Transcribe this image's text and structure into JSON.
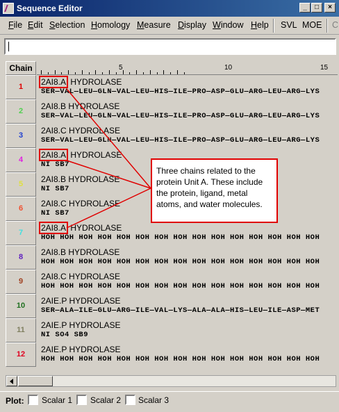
{
  "window": {
    "title": "Sequence Editor"
  },
  "menu": [
    {
      "label": "File",
      "ul": "F",
      "rest": "ile"
    },
    {
      "label": "Edit",
      "ul": "E",
      "rest": "dit"
    },
    {
      "label": "Selection",
      "ul": "S",
      "rest": "election"
    },
    {
      "label": "Homology",
      "ul": "H",
      "rest": "omology"
    },
    {
      "label": "Measure",
      "ul": "M",
      "rest": "easure"
    },
    {
      "label": "Display",
      "ul": "D",
      "rest": "isplay"
    },
    {
      "label": "Window",
      "ul": "W",
      "rest": "indow"
    },
    {
      "label": "Help",
      "ul": "H",
      "rest": "elp"
    }
  ],
  "toolbar": {
    "svl": "SVL",
    "moe": "MOE",
    "extra": "C"
  },
  "command": {
    "value": ""
  },
  "ruler": {
    "header": "Chain",
    "marks": [
      "5",
      "10",
      "15"
    ]
  },
  "rows": [
    {
      "chain": "1",
      "color": "#e00000",
      "pdb": "2AI8.A",
      "name": "HYDROLASE",
      "highlight": true,
      "residues": "SER—VAL—LEU—GLN—VAL—LEU—HIS—ILE—PRO—ASP—GLU—ARG—LEU—ARG—LYS"
    },
    {
      "chain": "2",
      "color": "#50d050",
      "pdb": "2AI8.B",
      "name": "HYDROLASE",
      "highlight": false,
      "residues": "SER—VAL—LEU—GLN—VAL—LEU—HIS—ILE—PRO—ASP—GLU—ARG—LEU—ARG—LYS"
    },
    {
      "chain": "3",
      "color": "#2040d0",
      "pdb": "2AI8.C",
      "name": "HYDROLASE",
      "highlight": false,
      "residues": "SER—VAL—LEU—GLN—VAL—LEU—HIS—ILE—PRO—ASP—GLU—ARG—LEU—ARG—LYS"
    },
    {
      "chain": "4",
      "color": "#e020e0",
      "pdb": "2AI8.A",
      "name": "HYDROLASE",
      "highlight": true,
      "residues": "NI  SB7"
    },
    {
      "chain": "5",
      "color": "#e0e040",
      "pdb": "2AI8.B",
      "name": "HYDROLASE",
      "highlight": false,
      "residues": "NI  SB7"
    },
    {
      "chain": "6",
      "color": "#f05030",
      "pdb": "2AI8.C",
      "name": "HYDROLASE",
      "highlight": false,
      "residues": "NI  SB7"
    },
    {
      "chain": "7",
      "color": "#40e0e0",
      "pdb": "2AI8.A",
      "name": "HYDROLASE",
      "highlight": true,
      "residues": "HOH HOH HOH HOH HOH HOH HOH HOH HOH HOH HOH HOH HOH HOH HOH"
    },
    {
      "chain": "8",
      "color": "#6020c0",
      "pdb": "2AI8.B",
      "name": "HYDROLASE",
      "highlight": false,
      "residues": "HOH HOH HOH HOH HOH HOH HOH HOH HOH HOH HOH HOH HOH HOH HOH"
    },
    {
      "chain": "9",
      "color": "#a04020",
      "pdb": "2AI8.C",
      "name": "HYDROLASE",
      "highlight": false,
      "residues": "HOH HOH HOH HOH HOH HOH HOH HOH HOH HOH HOH HOH HOH HOH HOH"
    },
    {
      "chain": "10",
      "color": "#207020",
      "pdb": "2AIE.P",
      "name": "HYDROLASE",
      "highlight": false,
      "residues": "SER—ALA—ILE—GLU—ARG—ILE—VAL—LYS—ALA—ALA—HIS—LEU—ILE—ASP—MET"
    },
    {
      "chain": "11",
      "color": "#808060",
      "pdb": "2AIE.P",
      "name": "HYDROLASE",
      "highlight": false,
      "residues": "NI  SO4 SB9"
    },
    {
      "chain": "12",
      "color": "#e00020",
      "pdb": "2AIE.P",
      "name": "HYDROLASE",
      "highlight": false,
      "residues": "HOH HOH HOH HOH HOH HOH HOH HOH HOH HOH HOH HOH HOH HOH HOH"
    }
  ],
  "callout": {
    "text": "Three chains related to the protein Unit A. These include the protein, ligand, metal atoms, and water molecules."
  },
  "plot": {
    "label": "Plot:",
    "options": [
      "Scalar 1",
      "Scalar 2",
      "Scalar 3"
    ]
  }
}
